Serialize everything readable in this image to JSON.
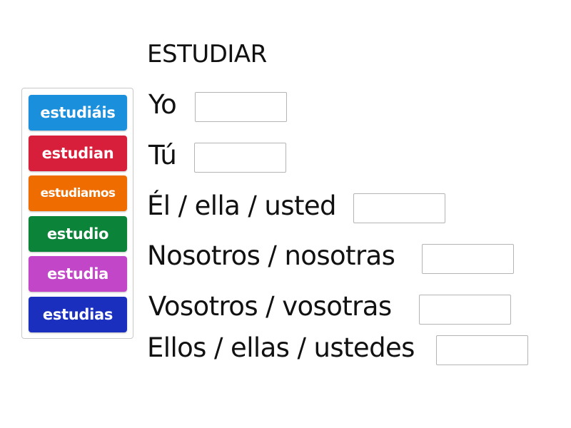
{
  "title": "ESTUDIAR",
  "word_bank": [
    {
      "text": "estudiáis",
      "color": "#1a8fdb"
    },
    {
      "text": "estudian",
      "color": "#d71f3b"
    },
    {
      "text": "estudiamos",
      "color": "#ee6c00"
    },
    {
      "text": "estudio",
      "color": "#0b8338"
    },
    {
      "text": "estudia",
      "color": "#c146c8"
    },
    {
      "text": "estudias",
      "color": "#1b2fbf"
    }
  ],
  "rows": [
    {
      "label": "Yo",
      "answer": ""
    },
    {
      "label": "Tú",
      "answer": ""
    },
    {
      "label": "Él / ella / usted",
      "answer": ""
    },
    {
      "label": "Nosotros / nosotras",
      "answer": ""
    },
    {
      "label": "Vosotros / vosotras",
      "answer": ""
    },
    {
      "label": "Ellos / ellas / ustedes",
      "answer": ""
    }
  ]
}
